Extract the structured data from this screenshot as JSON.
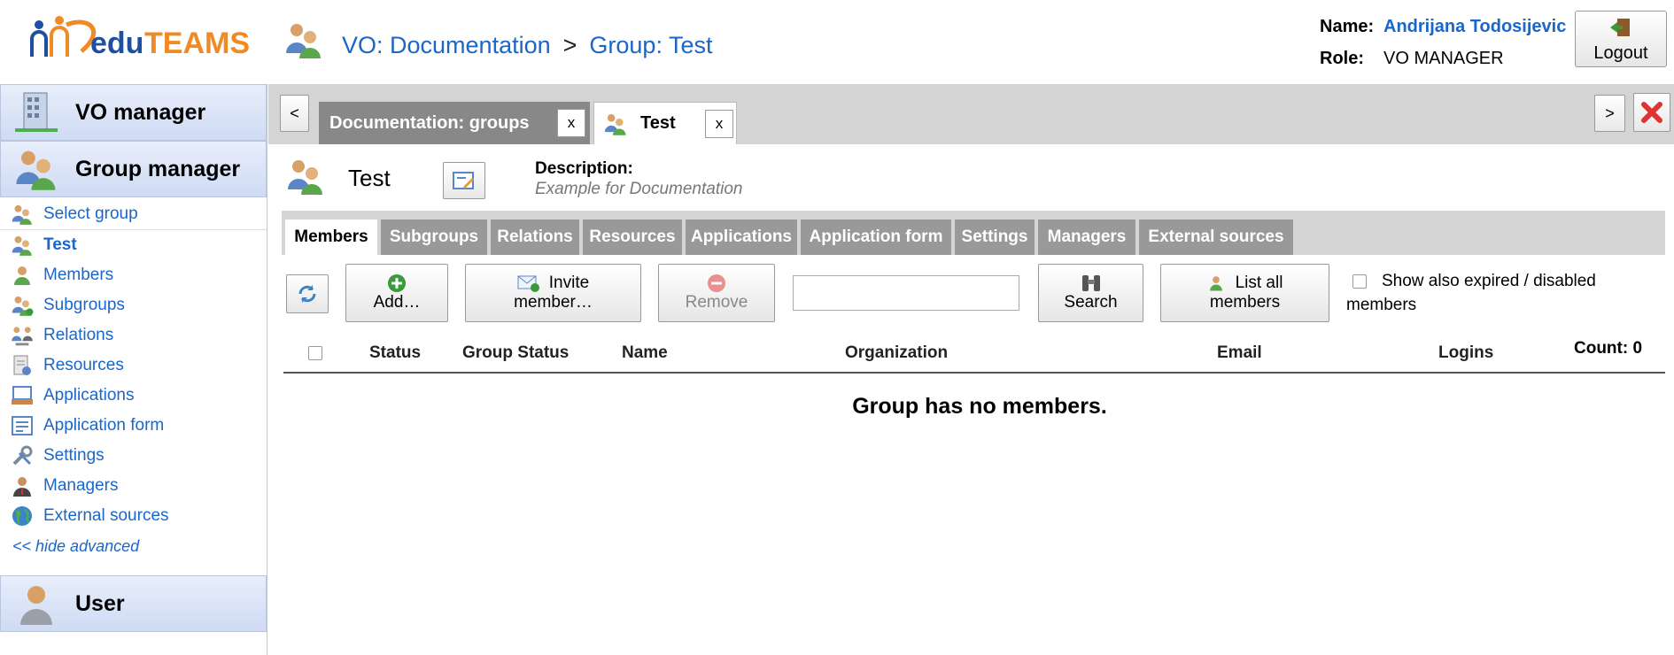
{
  "header": {
    "brand": "eduTEAMS",
    "vo_link": "VO: Documentation",
    "separator": ">",
    "group_link": "Group: Test",
    "name_label": "Name:",
    "user_name": "Andrijana Todosijevic",
    "role_label": "Role:",
    "role_value": "VO MANAGER",
    "logout_label": "Logout"
  },
  "sidebar": {
    "vo_manager": "VO manager",
    "group_manager": "Group manager",
    "items": [
      {
        "label": "Select group",
        "icon": "group-icon"
      },
      {
        "label": "Test",
        "icon": "group-icon"
      },
      {
        "label": "Members",
        "icon": "user-icon"
      },
      {
        "label": "Subgroups",
        "icon": "subgroups-icon"
      },
      {
        "label": "Relations",
        "icon": "relations-icon"
      },
      {
        "label": "Resources",
        "icon": "resources-icon"
      },
      {
        "label": "Applications",
        "icon": "applications-icon"
      },
      {
        "label": "Application form",
        "icon": "form-icon"
      },
      {
        "label": "Settings",
        "icon": "settings-icon"
      },
      {
        "label": "Managers",
        "icon": "manager-icon"
      },
      {
        "label": "External sources",
        "icon": "globe-icon"
      }
    ],
    "hide_advanced": "<< hide advanced",
    "user": "User"
  },
  "tabs": {
    "prev": "<",
    "next": ">",
    "tab1": "Documentation: groups",
    "tab2": "Test",
    "close": "x"
  },
  "group": {
    "title": "Test",
    "description_label": "Description:",
    "description": "Example for Documentation"
  },
  "section_tabs": [
    "Members",
    "Subgroups",
    "Relations",
    "Resources",
    "Applications",
    "Application form",
    "Settings",
    "Managers",
    "External sources"
  ],
  "toolbar": {
    "add": "Add…",
    "invite_line1": "Invite",
    "invite_line2": "member…",
    "remove": "Remove",
    "search_value": "",
    "search": "Search",
    "list_all_line1": "List all",
    "list_all_line2": "members",
    "show_expired": "Show also expired / disabled members"
  },
  "table": {
    "columns": [
      "Status",
      "Group Status",
      "Name",
      "Organization",
      "Email",
      "Logins"
    ],
    "count": "Count: 0",
    "empty": "Group has no members."
  },
  "colors": {
    "link": "#1a66c9",
    "tab_bar": "#d4d4d4",
    "logo_orange": "#f08a24"
  }
}
